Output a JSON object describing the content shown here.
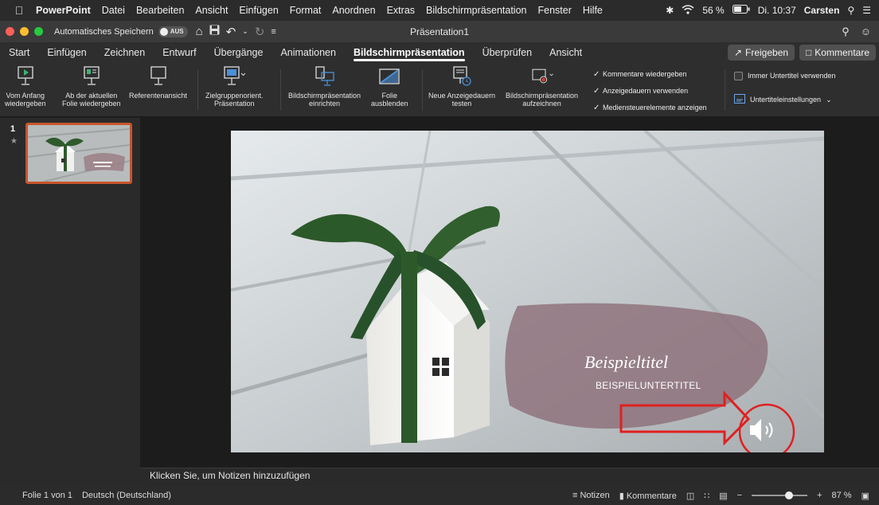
{
  "menubar": {
    "app": "PowerPoint",
    "items": [
      "Datei",
      "Bearbeiten",
      "Ansicht",
      "Einfügen",
      "Format",
      "Anordnen",
      "Extras",
      "Bildschirmpräsentation",
      "Fenster",
      "Hilfe"
    ],
    "battery": "56 %",
    "clock": "Di. 10:37",
    "user": "Carsten"
  },
  "titlebar": {
    "autosave_label": "Automatisches Speichern",
    "autosave_state": "AUS",
    "document_title": "Präsentation1"
  },
  "tabs": {
    "items": [
      "Start",
      "Einfügen",
      "Zeichnen",
      "Entwurf",
      "Übergänge",
      "Animationen",
      "Bildschirmpräsentation",
      "Überprüfen",
      "Ansicht"
    ],
    "active": "Bildschirmpräsentation",
    "share_label": "Freigeben",
    "comments_label": "Kommentare"
  },
  "ribbon": {
    "from_start": [
      "Vom Anfang",
      "wiedergeben"
    ],
    "from_current": [
      "Ab der aktuellen",
      "Folie wiedergeben"
    ],
    "presenter_view": "Referentenansicht",
    "custom_show": [
      "Zielgruppenorient.",
      "Präsentation"
    ],
    "setup_show": [
      "Bildschirmpräsentation",
      "einrichten"
    ],
    "hide_slide": [
      "Folie",
      "ausblenden"
    ],
    "rehearse": [
      "Neue Anzeigedauern",
      "testen"
    ],
    "record": [
      "Bildschirmpräsentation",
      "aufzeichnen"
    ],
    "checks": [
      "Kommentare wiedergeben",
      "Anzeigedauern verwenden",
      "Mediensteuerelemente anzeigen"
    ],
    "always_subtitles": "Immer Untertitel verwenden",
    "subtitle_settings": "Untertiteleinstellungen"
  },
  "slide_panel": {
    "number": "1"
  },
  "slide": {
    "title": "Beispieltitel",
    "subtitle": "BEISPIELUNTERTITEL"
  },
  "notes": {
    "placeholder": "Klicken Sie, um Notizen hinzuzufügen"
  },
  "status": {
    "slide_of": "Folie 1 von 1",
    "language": "Deutsch (Deutschland)",
    "notes_btn": "Notizen",
    "comments_btn": "Kommentare",
    "zoom": "87 %"
  }
}
